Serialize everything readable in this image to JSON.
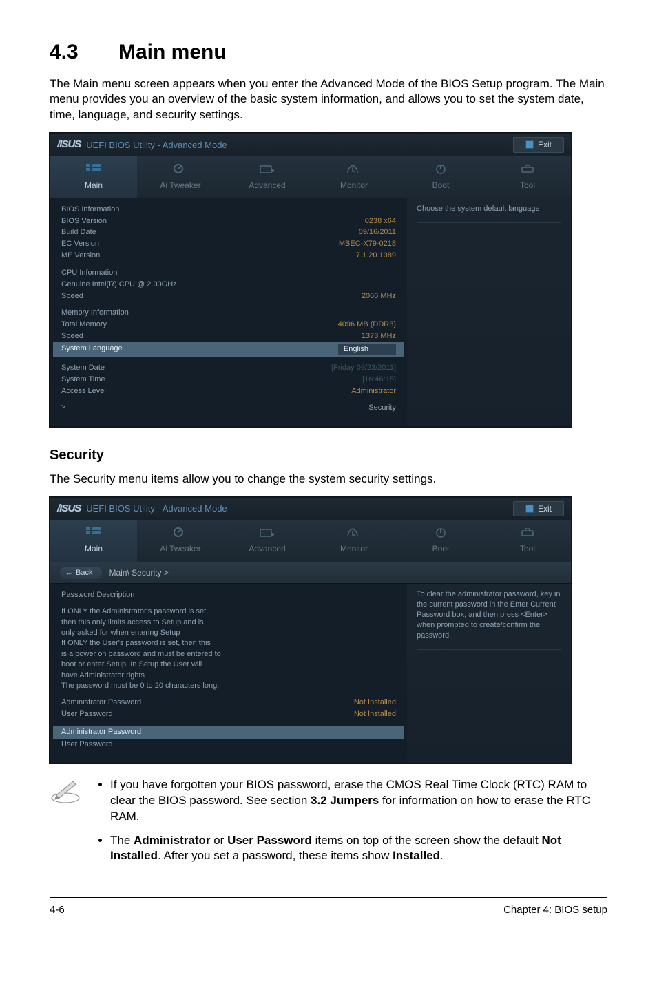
{
  "doc": {
    "section_number": "4.3",
    "section_title": "Main menu",
    "intro": "The Main menu screen appears when you enter the Advanced Mode of the BIOS Setup program. The Main menu provides you an overview of the basic system information, and allows you to set the system date, time, language, and security settings.",
    "security_heading": "Security",
    "security_intro": "The Security menu items allow you to change the system security settings.",
    "note1_a": "If you have forgotten your BIOS password, erase the CMOS Real Time Clock (RTC) RAM to clear the BIOS password. See section ",
    "note1_b": "3.2 Jumpers",
    "note1_c": " for information on how to erase the RTC RAM.",
    "note2_a": "The ",
    "note2_b": "Administrator",
    "note2_c": " or ",
    "note2_d": "User Password",
    "note2_e": " items on top of the screen show the default ",
    "note2_f": "Not Installed",
    "note2_g": ". After you set a password, these items show ",
    "note2_h": "Installed",
    "note2_i": ".",
    "page_left": "4-6",
    "page_right": "Chapter 4: BIOS setup"
  },
  "bios1": {
    "title": "UEFI BIOS Utility - Advanced Mode",
    "exit": "Exit",
    "tabs": {
      "main": "Main",
      "tweaker": "Ai Tweaker",
      "advanced": "Advanced",
      "monitor": "Monitor",
      "boot": "Boot",
      "tool": "Tool"
    },
    "help": "Choose the system default language",
    "groups": {
      "bios_info": "BIOS Information",
      "bios_version_label": "BIOS Version",
      "bios_version_val": "0238 x64",
      "build_date_label": "Build Date",
      "build_date_val": "09/16/2011",
      "ec_label": "EC Version",
      "ec_val": "MBEC-X79-0218",
      "me_label": "ME Version",
      "me_val": "7.1.20.1089",
      "cpu_info": "CPU Information",
      "cpu_name": "Genuine Intel(R) CPU @ 2.00GHz",
      "cpu_speed_label": "Speed",
      "cpu_speed_val": "2066 MHz",
      "mem_info": "Memory Information",
      "total_mem_label": "Total Memory",
      "total_mem_val": "4096 MB (DDR3)",
      "mem_speed_label": "Speed",
      "mem_speed_val": "1373 MHz",
      "sys_lang_label": "System Language",
      "sys_lang_val": "English",
      "sys_date_label": "System Date",
      "sys_date_val": "[Friday 09/23/2011]",
      "sys_time_label": "System Time",
      "sys_time_val": "[16:46:15]",
      "access_label": "Access Level",
      "access_val": "Administrator",
      "security": "Security"
    }
  },
  "bios2": {
    "title": "UEFI BIOS Utility - Advanced Mode",
    "exit": "Exit",
    "breadcrumb_back": "Back",
    "breadcrumb": "Main\\ Security >",
    "tabs": {
      "main": "Main",
      "tweaker": "Ai Tweaker",
      "advanced": "Advanced",
      "monitor": "Monitor",
      "boot": "Boot",
      "tool": "Tool"
    },
    "help": "To clear the administrator password, key in the current password in the Enter Current Password box, and then press <Enter> when prompted to create/confirm the password.",
    "desc_heading": "Password Description",
    "desc_l1": "If ONLY the Administrator's password is set,",
    "desc_l2": "then this only limits access to Setup and is",
    "desc_l3": "only asked for when entering Setup",
    "desc_l4": "If ONLY the User's password is set, then this",
    "desc_l5": "is a power on password and must be entered to",
    "desc_l6": "boot or enter Setup. In Setup the User will",
    "desc_l7": "have Administrator rights",
    "desc_l8": "The password must be 0 to 20 characters long.",
    "admin_pw_label": "Administrator Password",
    "admin_pw_val": "Not Installed",
    "user_pw_label": "User Password",
    "user_pw_val": "Not Installed",
    "admin_pw_item": "Administrator Password",
    "user_pw_item": "User Password"
  }
}
